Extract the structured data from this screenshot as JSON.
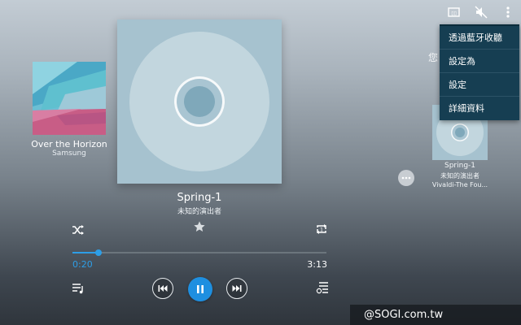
{
  "toolbar": {
    "icons": [
      "cast-icon",
      "mute-icon",
      "overflow-menu-icon"
    ]
  },
  "menu": {
    "items": [
      "透過藍牙收聽",
      "設定為",
      "設定",
      "詳細資料"
    ]
  },
  "previous_track": {
    "title": "Over the Horizon",
    "artist": "Samsung"
  },
  "current_track": {
    "title": "Spring-1",
    "artist": "未知的演出者"
  },
  "next_track": {
    "partial_text": "您",
    "title": "Spring-1",
    "artist": "未知的演出者",
    "album": "Vivaldi-The Fou..."
  },
  "playback": {
    "elapsed": "0:20",
    "total": "3:13",
    "progress_fraction": 0.1036,
    "state": "playing"
  },
  "colors": {
    "accent": "#2d9ee6",
    "menu_bg": "#163e52",
    "art_bg": "#a6c2cf"
  },
  "watermark": "@SOGI.com.tw"
}
